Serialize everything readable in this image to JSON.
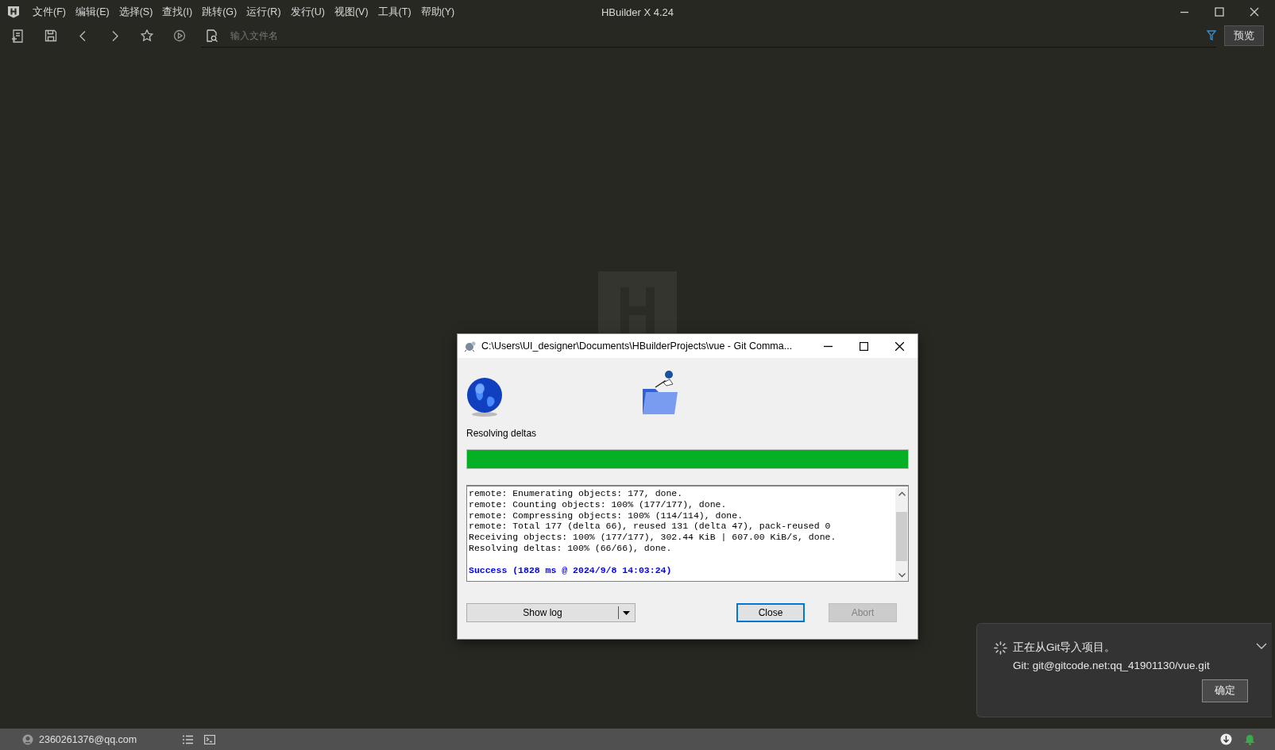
{
  "app": {
    "title": "HBuilder X 4.24",
    "menu": [
      "文件(F)",
      "编辑(E)",
      "选择(S)",
      "查找(I)",
      "跳转(G)",
      "运行(R)",
      "发行(U)",
      "视图(V)",
      "工具(T)",
      "帮助(Y)"
    ]
  },
  "toolbar": {
    "search": {
      "placeholder": "输入文件名"
    },
    "preview_button": "预览"
  },
  "dialog": {
    "title": "C:\\Users\\UI_designer\\Documents\\HBuilderProjects\\vue - Git Comma...",
    "status": "Resolving deltas",
    "progress": {
      "level": 1
    },
    "log": [
      {
        "kind": "normal",
        "text": "remote: Enumerating objects: 177, done."
      },
      {
        "kind": "normal",
        "text": "remote: Counting objects: 100% (177/177), done."
      },
      {
        "kind": "normal",
        "text": "remote: Compressing objects: 100% (114/114), done."
      },
      {
        "kind": "normal",
        "text": "remote: Total 177 (delta 66), reused 131 (delta 47), pack-reused 0"
      },
      {
        "kind": "normal",
        "text": "Receiving objects: 100% (177/177), 302.44 KiB | 607.00 KiB/s, done."
      },
      {
        "kind": "normal",
        "text": "Resolving deltas: 100% (66/66), done."
      },
      {
        "kind": "success",
        "text": "Success (1828 ms @ 2024/9/8 14:03:24)"
      }
    ],
    "buttons": [
      {
        "kind": "split",
        "label": "Show log",
        "default": false,
        "disabled": false
      },
      {
        "kind": "plain",
        "label": "Close",
        "default": true,
        "disabled": false
      },
      {
        "kind": "plain",
        "label": "Abort",
        "default": false,
        "disabled": true
      }
    ]
  },
  "notification": {
    "message": "正在从Git导入项目。",
    "detail": "Git: git@gitcode.net:qq_41901130/vue.git",
    "button": "确定"
  },
  "status_bar": {
    "account": "2360261376@qq.com"
  }
}
